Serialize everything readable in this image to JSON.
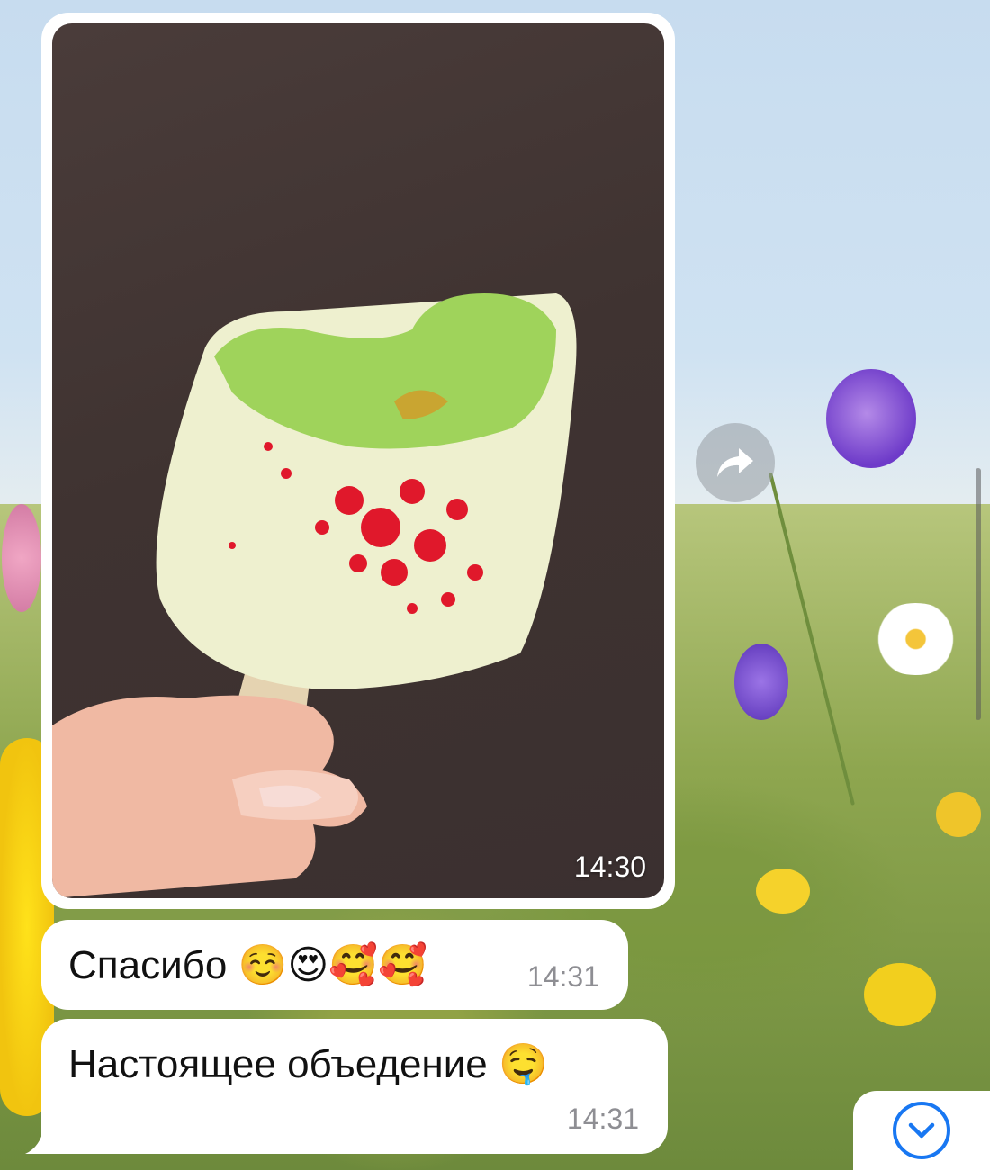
{
  "photo_message": {
    "time": "14:30"
  },
  "messages": [
    {
      "text": "Спасибо",
      "emoji": "☺️😍🥰🥰",
      "time": "14:31"
    },
    {
      "text": "Настоящее объедение",
      "emoji": "🤤",
      "time": "14:31"
    }
  ],
  "icons": {
    "forward": "forward-arrow-icon",
    "scroll_down": "chevron-down-circle-icon"
  },
  "colors": {
    "bubble": "#ffffff",
    "time_gray": "#8e8e93",
    "accent": "#1877f2"
  }
}
